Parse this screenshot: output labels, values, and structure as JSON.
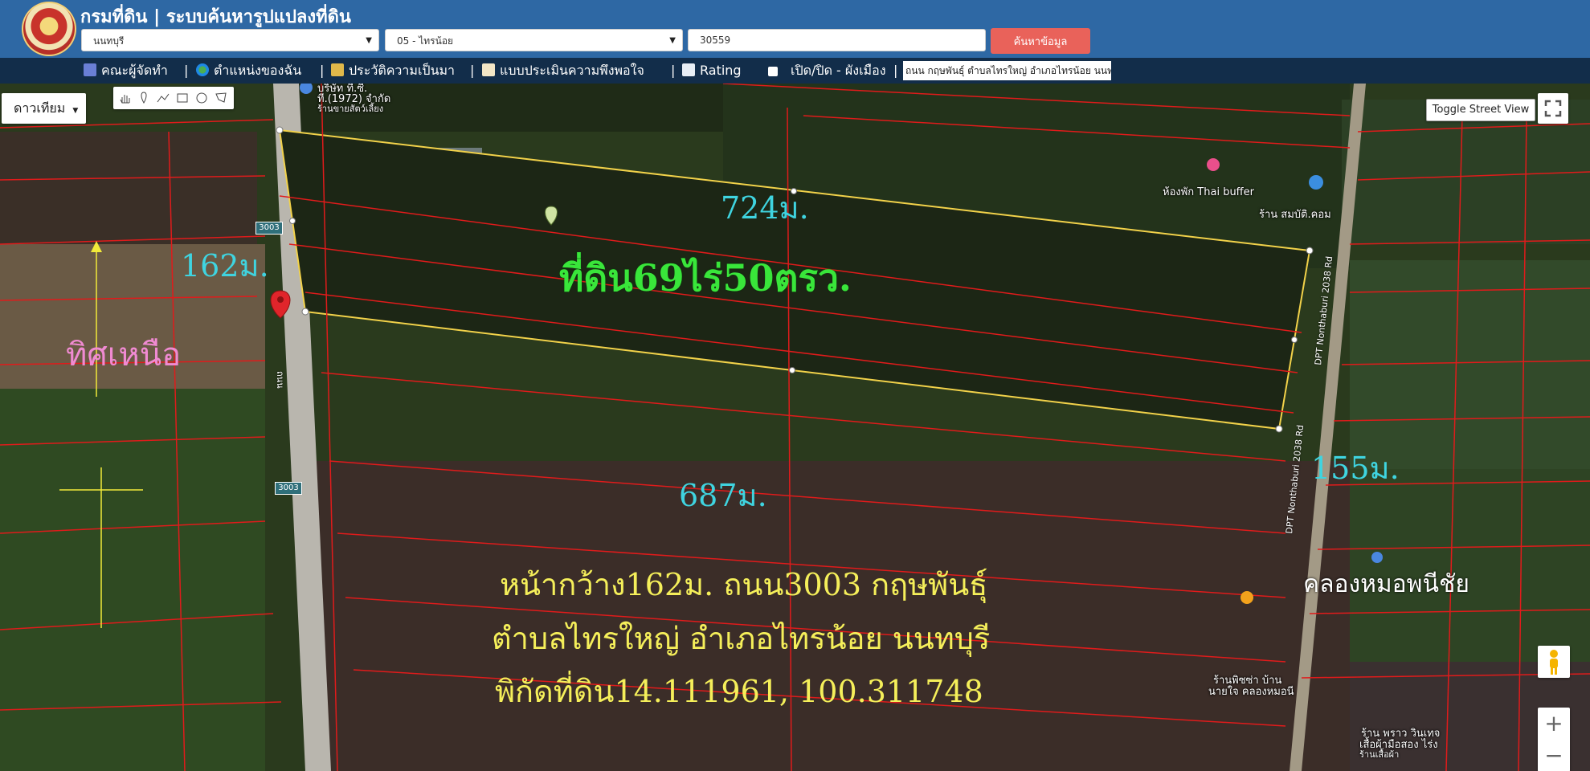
{
  "header": {
    "title": "กรมที่ดิน | ระบบค้นหารูปแปลงที่ดิน",
    "province_select": "นนทบุรี",
    "district_select": "05 - ไทรน้อย",
    "parcel_input": "30559",
    "search_button": "ค้นหาข้อมูล"
  },
  "navbar": {
    "items": [
      {
        "label": "คณะผู้จัดทำ",
        "icon": "team-icon"
      },
      {
        "label": "ตำแหน่งของฉัน",
        "icon": "globe-icon"
      },
      {
        "label": "ประวัติความเป็นมา",
        "icon": "history-icon"
      },
      {
        "label": "แบบประเมินความพึงพอใจ",
        "icon": "form-icon"
      },
      {
        "label": "Rating",
        "icon": "chart-icon"
      },
      {
        "label": "เปิด/ปิด - ผังเมือง",
        "icon": "checkbox-icon"
      }
    ],
    "separator": "|",
    "address": "ถนน กฤษพันธุ์ ตำบลไทรใหญ่ อำเภอไทรน้อย นนทบุรี"
  },
  "map": {
    "map_type": "ดาวเทียม",
    "toggle_street_view": "Toggle Street View",
    "zoom_in": "+",
    "zoom_out": "−",
    "overlay": {
      "north_label": "ทิศเหนือ",
      "dim_top": "724ม.",
      "dim_left": "162ม.",
      "dim_right": "155ม.",
      "dim_bottom": "687ม.",
      "area": "ที่ดิน69ไร่50ตรว.",
      "line1": "หน้ากว้าง162ม. ถนน3003 กฤษพันธุ์",
      "line2": "ตำบลไทรใหญ่ อำเภอไทรน้อย นนทบุรี",
      "line3": "พิกัดที่ดิน14.111961, 100.311748",
      "canal": "คลองหมอพนีชัย"
    },
    "pois": {
      "company": "บริษัท ที.ซี.",
      "company2": "ที.(1972) จำกัด",
      "company3": "ร้านขายสัตว์เลี้ยง",
      "hotel": "ห้องพัก Thai buffer",
      "shop": "ร้าน สมบัติ.คอม",
      "pizza1": "ร้านพิซซ่า บ้าน",
      "pizza2": "นายใจ คลองหมอนี",
      "shop2": "ร้าน พราว วินเทจ",
      "shop3": "เสื้อผ้ามือสอง ไร่ง",
      "shop4": "ร้านเสื้อผ้า"
    },
    "roads": {
      "shield": "3003",
      "road_vertical": "DPT Nonthaburi 2038 Rd",
      "road_thai": "ถนน"
    }
  }
}
